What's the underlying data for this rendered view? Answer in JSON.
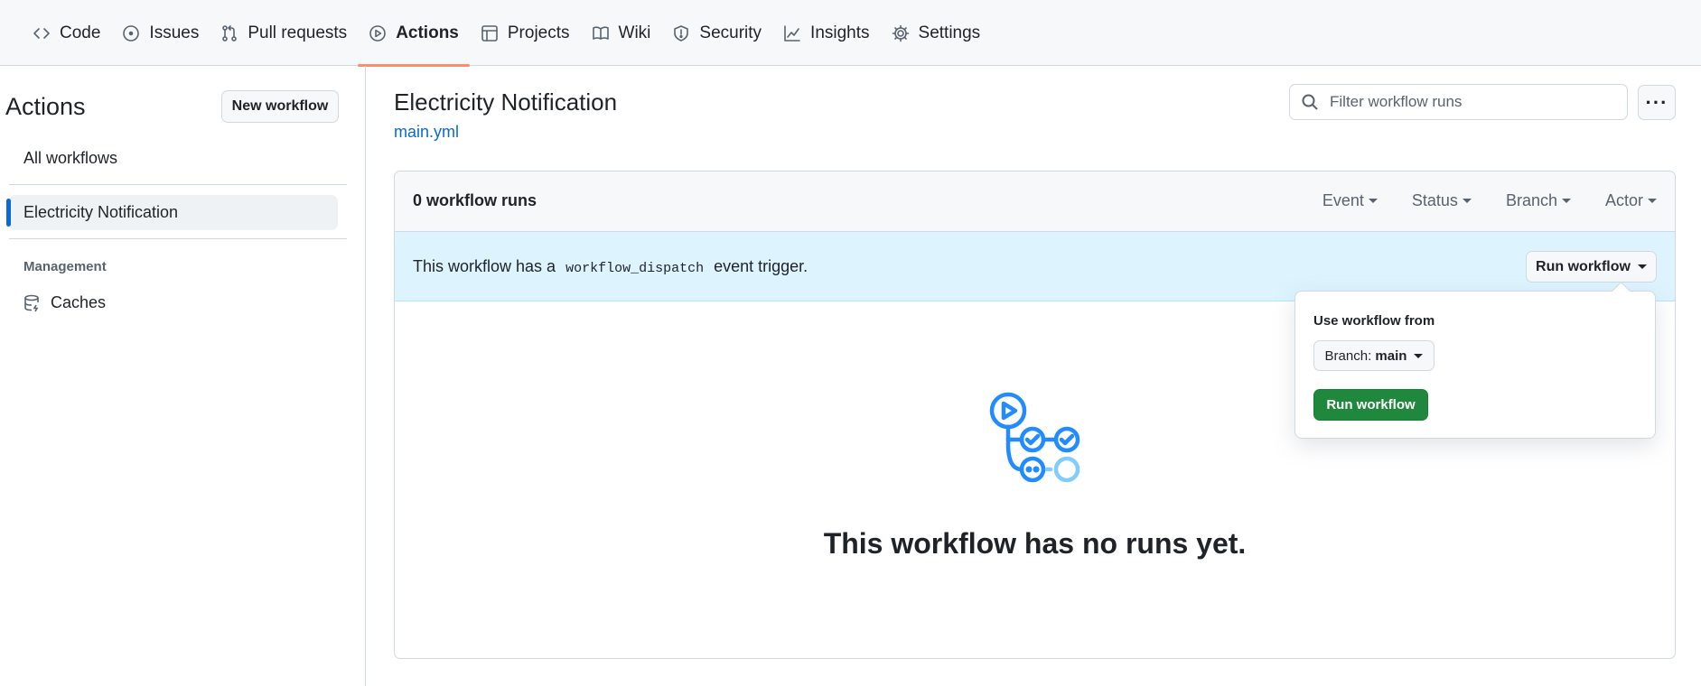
{
  "repo_nav": {
    "tabs": [
      {
        "label": "Code",
        "icon": "code-icon",
        "active": false
      },
      {
        "label": "Issues",
        "icon": "issue-icon",
        "active": false
      },
      {
        "label": "Pull requests",
        "icon": "pull-request-icon",
        "active": false
      },
      {
        "label": "Actions",
        "icon": "play-icon",
        "active": true
      },
      {
        "label": "Projects",
        "icon": "table-icon",
        "active": false
      },
      {
        "label": "Wiki",
        "icon": "book-icon",
        "active": false
      },
      {
        "label": "Security",
        "icon": "shield-icon",
        "active": false
      },
      {
        "label": "Insights",
        "icon": "graph-icon",
        "active": false
      },
      {
        "label": "Settings",
        "icon": "gear-icon",
        "active": false
      }
    ]
  },
  "sidebar": {
    "title": "Actions",
    "new_workflow_label": "New workflow",
    "all_workflows_label": "All workflows",
    "selected_workflow_label": "Electricity Notification",
    "management_heading": "Management",
    "caches_label": "Caches"
  },
  "main": {
    "workflow_title": "Electricity Notification",
    "workflow_file": "main.yml",
    "filter_placeholder": "Filter workflow runs",
    "kebab_label": "···",
    "runs_count": "0 workflow runs",
    "filters": [
      "Event",
      "Status",
      "Branch",
      "Actor"
    ],
    "banner_prefix": "This workflow has a",
    "banner_code": "workflow_dispatch",
    "banner_suffix": "event trigger.",
    "run_workflow_label": "Run workflow",
    "empty_message": "This workflow has no runs yet."
  },
  "dropdown": {
    "label": "Use workflow from",
    "branch_prefix": "Branch: ",
    "branch_name": "main",
    "submit_label": "Run workflow"
  },
  "colors": {
    "accent_blue": "#0969da",
    "tab_underline": "#fd8c73",
    "banner_bg": "#ddf4ff",
    "success_green": "#1f883d",
    "illustration_blue": "#218bff"
  }
}
